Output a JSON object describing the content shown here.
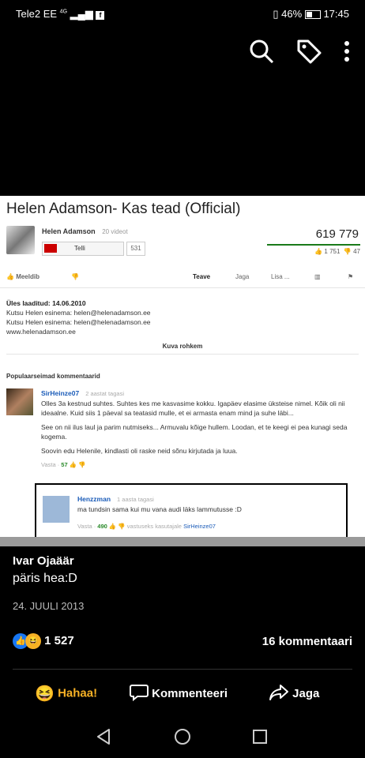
{
  "status_bar": {
    "carrier": "Tele2 EE",
    "network": "4G",
    "battery": "46%",
    "time": "17:45"
  },
  "viewer": {
    "icons": [
      "search-icon",
      "tag-icon",
      "more-vertical-icon"
    ]
  },
  "screenshot": {
    "title": "Helen Adamson- Kas tead (Official)",
    "channel": "Helen Adamson",
    "videos": "20 videot",
    "subscribe_label": "Telli",
    "subscriber_count": "531",
    "views": "619 779",
    "likes": "1 751",
    "dislikes": "47",
    "actions": {
      "like": "Meeldib",
      "about": "Teave",
      "share": "Jaga",
      "add": "Lisa ..."
    },
    "description": {
      "uploaded": "Üles laaditud: 14.06.2010",
      "line1": "Kutsu Helen esinema: helen@helenadamson.ee",
      "line2": "Kutsu Helen esinema: helen@helenadamson.ee",
      "line3": "www.helenadamson.ee",
      "more": "Kuva rohkem"
    },
    "popular_label": "Populaarseimad kommentaarid",
    "comment": {
      "author": "SirHeinze07",
      "time": "2 aastat tagasi",
      "p1": "Olles 3a kestnud suhtes. Suhtes kes me kasvasime kokku. Igapäev elasime üksteise nimel. Kõik oli nii ideaalne. Kuid siis 1 päeval sa teatasid mulle, et ei armasta enam mind ja suhe läbi...",
      "p2": "See on nii ilus laul ja parim nutmiseks... Armuvalu kõige hullem. Loodan, et te keegi ei pea kunagi seda kogema.",
      "p3": "Soovin edu Helenile, kindlasti oli raske neid sõnu kirjutada ja luua.",
      "reply_label": "Vasta",
      "votes": "57"
    },
    "reply": {
      "author": "Henzzman",
      "time": "1 aasta tagasi",
      "text": "ma tundsin sama kui mu vana audi läks lammutusse :D",
      "reply_label": "Vasta",
      "votes": "490",
      "in_reply": "vastuseks kasutajale",
      "in_reply_user": "SirHeinze07"
    }
  },
  "post": {
    "author": "Ivar Ojaäär",
    "text": "päris hea:D",
    "date": "24. JUULI 2013",
    "reactions": "1 527",
    "comments": "16 kommentaari"
  },
  "post_actions": {
    "haha": "Hahaa!",
    "comment": "Kommenteeri",
    "share": "Jaga"
  }
}
